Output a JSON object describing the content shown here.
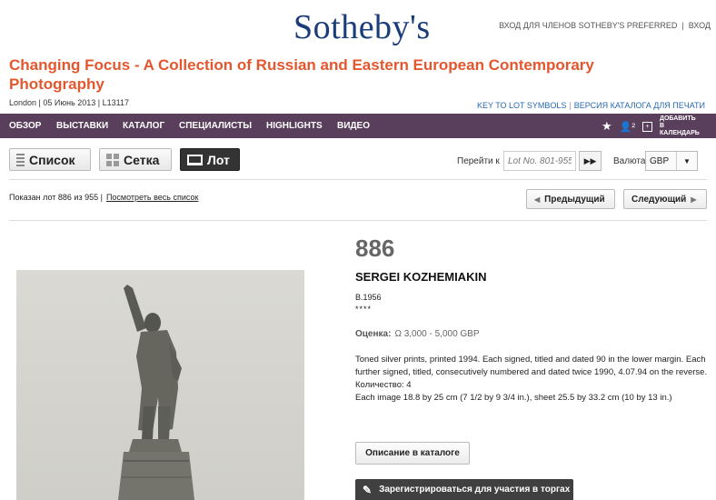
{
  "header": {
    "logo_text": "Sotheby's",
    "links": [
      "ВХОД ДЛЯ ЧЛЕНОВ SOTHEBY'S PREFERRED",
      "ВХОД"
    ],
    "link_separator": "|"
  },
  "sale": {
    "title": "Changing Focus - A Collection of Russian and Eastern European Contemporary Photography",
    "meta": "London | 05 Июнь 2013 | L13117",
    "links": [
      "KEY TO LOT SYMBOLS",
      "ВЕРСИЯ КАТАЛОГА ДЛЯ ПЕЧАТИ"
    ],
    "link_separator": "|"
  },
  "nav": {
    "items": [
      "ОБЗОР",
      "ВЫСТАВКИ",
      "КАТАЛОГ",
      "СПЕЦИАЛИСТЫ",
      "HIGHLIGHTS",
      "ВИДЕО"
    ],
    "calendar_label": "ДОБАВИТЬ В КАЛЕНДАРЬ",
    "star_icon": "★",
    "people_icon": "👤²"
  },
  "view_toggle": {
    "list": "Список",
    "grid": "Сетка",
    "lot": "Лот",
    "active": "lot"
  },
  "goto": {
    "label": "Перейти к",
    "placeholder": "Lot No. 801-955",
    "go_label": "▶▶"
  },
  "currency": {
    "label": "Валюта",
    "selected": "GBP",
    "caret": "▼"
  },
  "pager": {
    "showing": "Показан лот 886 из 955",
    "separator": "|",
    "view_all": "Посмотреть весь список",
    "prev": "Предыдущий",
    "next": "Следующий"
  },
  "lot": {
    "number": "886",
    "artist": "SERGEI KOZHEMIAKIN",
    "born": "B.1956",
    "stars": "****",
    "estimate_label": "Оценка:",
    "estimate_value": "Ω 3,000 - 5,000 GBP",
    "description": [
      "Toned silver prints, printed 1994. Each signed, titled and dated 90 in the lower margin. Each further signed, titled, consecutively numbered and dated twice 1990, 4.07.94 on the reverse.",
      "Количество: 4",
      "Each image 18.8 by 25 cm (7 1/2  by 9 3/4 in.), sheet 25.5 by 33.2 cm (10 by 13 in.)"
    ],
    "catalog_button": "Описание в каталоге",
    "register_button": "Зарегистрироваться для участия в торгах"
  },
  "colors": {
    "brand_blue": "#1a3c78",
    "title_orange": "#e4572e",
    "nav_purple": "#5a3f5c",
    "link_blue": "#2a6ab0"
  }
}
